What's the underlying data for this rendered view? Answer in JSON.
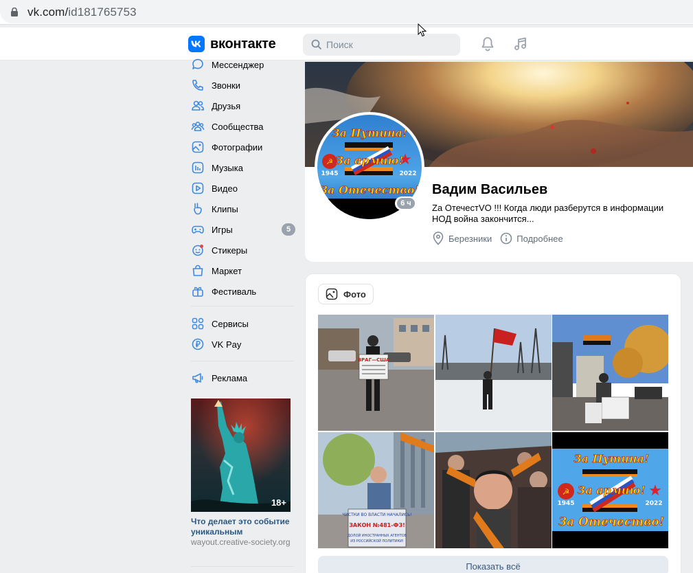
{
  "browser": {
    "url_host": "vk.com/",
    "url_path": "id181765753"
  },
  "header": {
    "logo_text": "вконтакте",
    "search_placeholder": "Поиск",
    "accent": "#0077ff"
  },
  "sidebar": {
    "items": [
      {
        "label": "Мессенджер",
        "icon": "messenger-icon"
      },
      {
        "label": "Звонки",
        "icon": "phone-icon"
      },
      {
        "label": "Друзья",
        "icon": "friends-icon"
      },
      {
        "label": "Сообщества",
        "icon": "communities-icon"
      },
      {
        "label": "Фотографии",
        "icon": "photos-icon"
      },
      {
        "label": "Музыка",
        "icon": "music-icon"
      },
      {
        "label": "Видео",
        "icon": "video-icon"
      },
      {
        "label": "Клипы",
        "icon": "clips-icon"
      },
      {
        "label": "Игры",
        "icon": "games-icon",
        "badge": "5"
      },
      {
        "label": "Стикеры",
        "icon": "stickers-icon"
      },
      {
        "label": "Маркет",
        "icon": "market-icon"
      },
      {
        "label": "Фестиваль",
        "icon": "festival-icon"
      },
      {
        "label": "Сервисы",
        "icon": "services-icon"
      },
      {
        "label": "VK Pay",
        "icon": "vkpay-icon"
      },
      {
        "label": "Реклама",
        "icon": "ads-icon"
      }
    ],
    "ad": {
      "age": "18+",
      "title": "Что делает это событие уникальным",
      "site": "wayout.creative-society.org"
    }
  },
  "profile": {
    "name": "Вадим Васильев",
    "status": "Za ОтечестVO !!! Когда люди разберутся в информации НОД война закончится...",
    "last_seen": "6 ч",
    "city": "Березники",
    "more": "Подробнее",
    "avatar_text": [
      "За Путина!",
      "За армию!",
      "За Отечество!",
      "1945",
      "2022"
    ]
  },
  "photos": {
    "tab_label": "Фото",
    "show_all": "Показать всё",
    "sign_texts": [
      "ВРАГ—США",
      "ЗАКОН №481-ФЗ!"
    ],
    "tile_text": [
      "За Путина!",
      "За армию!",
      "За Отечество!",
      "1945",
      "2022"
    ]
  }
}
